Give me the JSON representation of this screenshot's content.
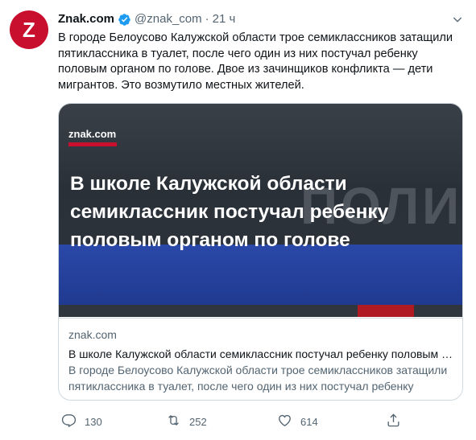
{
  "tweet": {
    "author_name": "Znak.com",
    "handle": "@znak_com",
    "separator": "·",
    "time": "21 ч",
    "avatar_letter": "Z",
    "text": "В городе Белоусово Калужской области трое семиклассников затащили пятиклассника в туалет, после чего один из них постучал ребенку половым органом по голове. Двое из зачинщиков конфликта — дети мигрантов. Это возмутило местных жителей."
  },
  "card": {
    "image_logo": "znak.com",
    "image_headline": "В школе Калужской области семиклассник постучал ребенку половым органом по голове",
    "image_background_word": "ПОЛИЦИЯ",
    "domain": "znak.com",
    "title": "В школе Калужской области семиклассник постучал ребенку половым органом по голове",
    "description": "В городе Белоусово Калужской области трое семиклассников затащили пятиклассника в туалет, после чего один из них постучал ребенку половым органом по голове."
  },
  "actions": {
    "replies": "130",
    "retweets": "252",
    "likes": "614"
  },
  "colors": {
    "brand_red": "#c8102e",
    "verified_blue": "#1d9bf0",
    "muted_text": "#536471"
  },
  "icons": [
    "verified-badge-icon",
    "chevron-down-icon",
    "reply-icon",
    "retweet-icon",
    "like-icon",
    "share-icon"
  ]
}
